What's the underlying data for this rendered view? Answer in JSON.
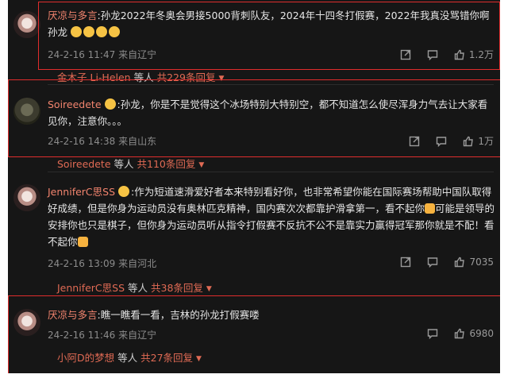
{
  "comments": [
    {
      "user": "厌凉与多言",
      "text": ":孙龙2022年冬奥会男接5000背刺队友，2024年十四冬打假赛，2022年我真没骂错你啊孙龙",
      "date": "24-2-16 11:47",
      "location": "来自辽宁",
      "likes": "1.2万",
      "reply_users": "金木子  Li-Helen",
      "reply_mid": "等人",
      "reply_count": "共229条回复"
    },
    {
      "user": "Soireedete",
      "text": ":孙龙，你是不是觉得这个冰场特别大特别空，都不知道怎么使尽浑身力气去让大家看见你，注意你。。。",
      "date": "24-2-16 14:38",
      "location": "来自山东",
      "likes": "1万",
      "reply_users": "Soireedete",
      "reply_mid": "等人",
      "reply_count": "共110条回复"
    },
    {
      "user": "JenniferC思SS",
      "text_a": ":作为短道速滑爱好者本来特别看好你，也非常希望你能在国际赛场帮助中国队取得好成绩，但是你身为运动员没有奥林匹克精神，国内赛次次都靠护滑拿第一，看不起你",
      "text_b": "可能是领导的安排你也只是棋子，但你身为运动员听从指令打假赛不反抗不公不是靠实力赢得冠军那你就是不配！看不起你",
      "date": "24-2-16 13:09",
      "location": "来自河北",
      "likes": "7035",
      "reply_users": "JenniferC思SS",
      "reply_mid": "等人",
      "reply_count": "共38条回复"
    },
    {
      "user": "厌凉与多言",
      "text": ":瞧一瞧看一看，吉林的孙龙打假赛喽",
      "date": "24-2-16 11:46",
      "location": "来自辽宁",
      "likes": "6980",
      "reply_users": "小阿D的梦想",
      "reply_mid": "等人",
      "reply_count": "共27条回复"
    }
  ]
}
